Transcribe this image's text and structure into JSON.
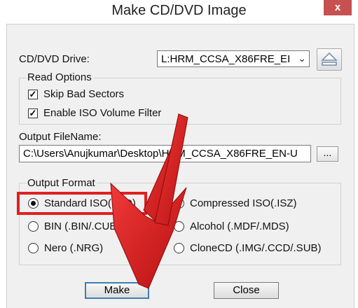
{
  "window": {
    "title": "Make CD/DVD Image",
    "close_glyph": "x"
  },
  "drive": {
    "label": "CD/DVD Drive:",
    "selected": "L:HRM_CCSA_X86FRE_EI",
    "eject_icon": "eject-icon"
  },
  "read_options": {
    "title": "Read Options",
    "skip_bad_sectors": {
      "label": "Skip Bad Sectors",
      "checked": true
    },
    "enable_iso_filter": {
      "label": "Enable ISO Volume Filter",
      "checked": true
    }
  },
  "output_filename": {
    "label": "Output FileName:",
    "value": "C:\\Users\\Anujkumar\\Desktop\\HRM_CCSA_X86FRE_EN-U",
    "browse_label": "..."
  },
  "output_format": {
    "title": "Output Format",
    "options": [
      {
        "label": "Standard ISO(.ISO)",
        "selected": true
      },
      {
        "label": "Compressed ISO(.ISZ)",
        "selected": false
      },
      {
        "label": "BIN (.BIN/.CUE)",
        "selected": false
      },
      {
        "label": "Alcohol (.MDF/.MDS)",
        "selected": false
      },
      {
        "label": "Nero (.NRG)",
        "selected": false
      },
      {
        "label": "CloneCD (.IMG/.CCD/.SUB)",
        "selected": false
      }
    ]
  },
  "buttons": {
    "make": "Make",
    "close": "Close"
  },
  "annotation": {
    "highlight_color": "#e02020",
    "arrow_color": "#d81a1a"
  }
}
